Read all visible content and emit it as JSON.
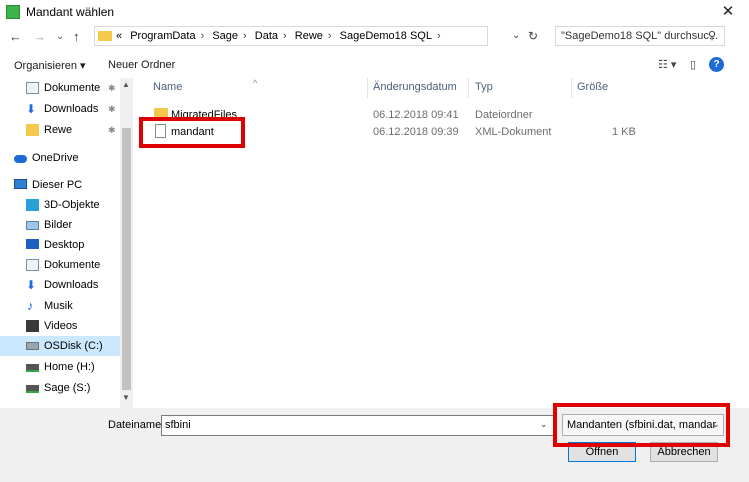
{
  "window": {
    "title": "Mandant wählen"
  },
  "nav": {
    "back": "←",
    "forward": "→",
    "history": "⌄",
    "up": "↑",
    "breadcrumbs": [
      "«",
      "ProgramData",
      "Sage",
      "Data",
      "Rewe",
      "SageDemo18 SQL"
    ],
    "crumb_separator": "›",
    "search_placeholder": "\"SageDemo18 SQL\" durchsuc..."
  },
  "toolbar": {
    "organize": "Organisieren",
    "new_folder": "Neuer Ordner"
  },
  "sidebar": [
    {
      "label": "Dokumente",
      "icon": "documents-icon",
      "pinned": true
    },
    {
      "label": "Downloads",
      "icon": "downloads-icon",
      "pinned": true
    },
    {
      "label": "Rewe",
      "icon": "folder-icon",
      "pinned": true
    },
    {
      "label": "OneDrive",
      "icon": "onedrive-icon"
    },
    {
      "label": "Dieser PC",
      "icon": "pc-icon"
    },
    {
      "label": "3D-Objekte",
      "icon": "3d-objects-icon"
    },
    {
      "label": "Bilder",
      "icon": "pictures-icon"
    },
    {
      "label": "Desktop",
      "icon": "desktop-icon"
    },
    {
      "label": "Dokumente",
      "icon": "documents-icon"
    },
    {
      "label": "Downloads",
      "icon": "downloads-icon"
    },
    {
      "label": "Musik",
      "icon": "music-icon"
    },
    {
      "label": "Videos",
      "icon": "videos-icon"
    },
    {
      "label": "OSDisk (C:)",
      "icon": "drive-icon",
      "selected": true
    },
    {
      "label": "Home (H:)",
      "icon": "network-drive-icon"
    },
    {
      "label": "Sage (S:)",
      "icon": "network-drive-icon"
    }
  ],
  "columns": [
    "Name",
    "Änderungsdatum",
    "Typ",
    "Größe"
  ],
  "files": [
    {
      "name": "MigratedFiles",
      "date": "06.12.2018 09:41",
      "type": "Dateiordner",
      "size": ""
    },
    {
      "name": "mandant",
      "date": "06.12.2018 09:39",
      "type": "XML-Dokument",
      "size": "1 KB"
    }
  ],
  "footer": {
    "filename_label": "Dateiname:",
    "filename_value": "sfbini",
    "filter_value": "Mandanten (sfbini.dat, mandar",
    "open": "Öffnen",
    "cancel": "Abbrechen"
  },
  "colors": {
    "accent": "#0078d7",
    "highlight": "#e00000",
    "folder": "#f3c84b"
  }
}
